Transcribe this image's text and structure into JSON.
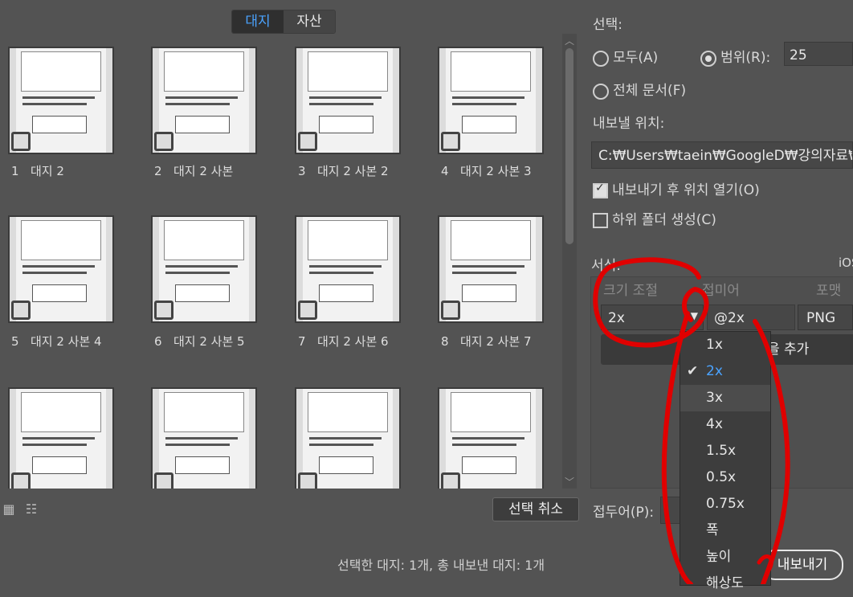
{
  "tabs": [
    {
      "label": "대지",
      "active": true
    },
    {
      "label": "자산",
      "active": false
    }
  ],
  "artboards": [
    {
      "num": "1",
      "name": "대지 2"
    },
    {
      "num": "2",
      "name": "대지 2 사본"
    },
    {
      "num": "3",
      "name": "대지 2 사본 2"
    },
    {
      "num": "4",
      "name": "대지 2 사본 3"
    },
    {
      "num": "5",
      "name": "대지 2 사본 4"
    },
    {
      "num": "6",
      "name": "대지 2 사본 5"
    },
    {
      "num": "7",
      "name": "대지 2 사본 6"
    },
    {
      "num": "8",
      "name": "대지 2 사본 7"
    },
    {
      "num": "",
      "name": ""
    },
    {
      "num": "",
      "name": ""
    },
    {
      "num": "",
      "name": ""
    },
    {
      "num": "",
      "name": ""
    }
  ],
  "deselect_button": "선택 취소",
  "status": "선택한 대지: 1개, 총 내보낸 대지: 1개",
  "selection": {
    "heading": "선택:",
    "all": "모두(A)",
    "range": "범위(R):",
    "range_value": "25",
    "whole_doc": "전체 문서(F)"
  },
  "export_to": {
    "heading": "내보낼 위치:",
    "path": "C:₩Users₩taein₩GoogleD₩강의자료₩...",
    "open_after": "내보내기 후 위치 열기(O)",
    "open_after_checked": true,
    "subfolder": "하위 폴더 생성(C)",
    "subfolder_checked": false
  },
  "format": {
    "heading": "서식:",
    "ios": "iOS",
    "col_scale": "크기 조절",
    "col_suffix": "접미어",
    "col_format": "포맷",
    "scale_value": "2x",
    "suffix_value": "@2x",
    "format_value": "PNG",
    "add_scale": "을 추가"
  },
  "prefix_label": "접두어(P):",
  "export_button": "내보내기",
  "scale_menu": {
    "items": [
      "1x",
      "2x",
      "3x",
      "4x",
      "1.5x",
      "0.5x",
      "0.75x",
      "폭",
      "높이",
      "해상도"
    ],
    "selected": "2x",
    "highlighted": "3x"
  },
  "colors": {
    "accent": "#4aa3ff",
    "annotation": "#e00000",
    "background": "#535353"
  }
}
